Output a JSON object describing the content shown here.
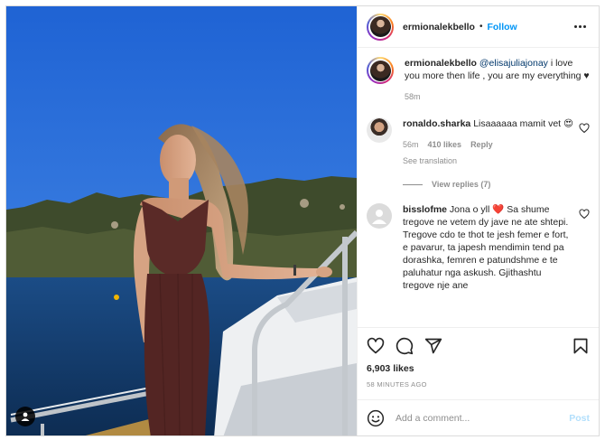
{
  "header": {
    "username": "ermionalekbello",
    "separator": "•",
    "follow_label": "Follow"
  },
  "caption": {
    "username": "ermionalekbello",
    "mention": "@elisajuliajonay",
    "text": " i love you more then life , you are my everything ♥",
    "time": "58m"
  },
  "comments": [
    {
      "username": "ronaldo.sharka",
      "text": " Lisaaaaaa mamit vet 😍",
      "time": "56m",
      "likes": "410 likes",
      "reply_label": "Reply",
      "translation_label": "See translation",
      "view_replies": "View replies (7)"
    },
    {
      "username": "bisslofme",
      "text": " Jona o yll ❤️ Sa shume tregove ne vetem dy jave ne ate shtepi. Tregove cdo te thot te jesh femer e fort, e pavarur, ta japesh mendimin tend pa dorashka, femren e patundshme e te paluhatur nga askush. Gjithashtu tregove nje ane"
    }
  ],
  "footer": {
    "likes": "6,903 likes",
    "timestamp": "58 MINUTES AGO",
    "comment_placeholder": "Add a comment...",
    "post_label": "Post"
  },
  "icons": {
    "like": "heart-icon",
    "comment": "comment-icon",
    "share": "share-icon",
    "save": "bookmark-icon",
    "emoji": "emoji-icon",
    "tag": "user-tag-icon",
    "more": "more-options-icon"
  },
  "colors": {
    "accent": "#0095f6",
    "post_disabled": "#b2dffc",
    "muted": "#8e8e8e",
    "text": "#262626"
  }
}
